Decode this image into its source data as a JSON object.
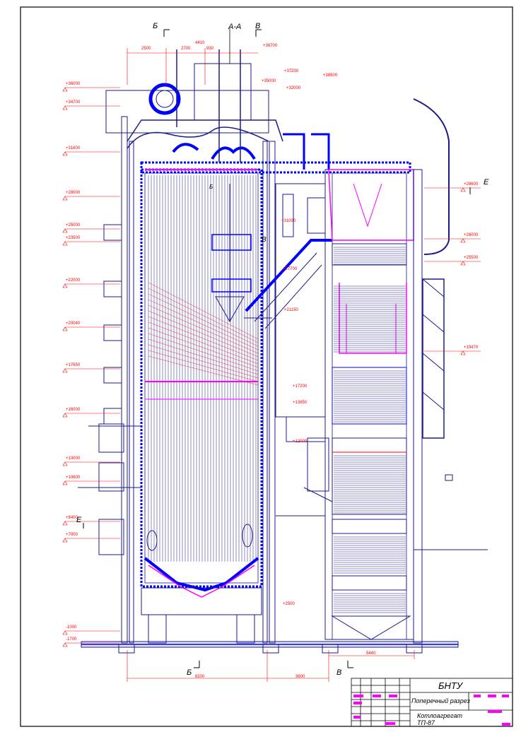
{
  "sections": {
    "aa": "А-А",
    "b_top": "Б",
    "v_top": "В",
    "b_mid": "Б",
    "v_mid": "В",
    "e_right": "Е",
    "e_left": "Е",
    "b_bottom": "Б",
    "v_bottom": "В"
  },
  "dimensions": {
    "d1": "2500",
    "d2": "2700",
    "d3": "4410",
    "d4": "930",
    "d5": "8200",
    "d6": "3600",
    "d7": "5440"
  },
  "elevations_left": [
    "+36000",
    "+34700",
    "+31600",
    "+28000",
    "+25000",
    "+23500",
    "+22000",
    "+20040",
    "+17650",
    "+16000",
    "+13000",
    "+10600",
    "+8400",
    "+7000",
    "-1000",
    "-1700"
  ],
  "elevations_right": [
    "+28600",
    "+26000",
    "+25500",
    "+19470"
  ],
  "elevations_inner": [
    "+36700",
    "+37200",
    "+35000",
    "+32000",
    "+38500",
    "+31000",
    "+27700",
    "+21150",
    "+17200",
    "+13850",
    "+12000",
    "+2500"
  ],
  "title_block": {
    "org": "БНТУ",
    "title": "Поперечный разрез",
    "model_line1": "Котлоагрегат",
    "model_line2": "ТП-87"
  },
  "colors": {
    "outline": "#1a1a8c",
    "blue": "#0000ff",
    "red": "#ff0000",
    "magenta": "#ff00ff"
  }
}
